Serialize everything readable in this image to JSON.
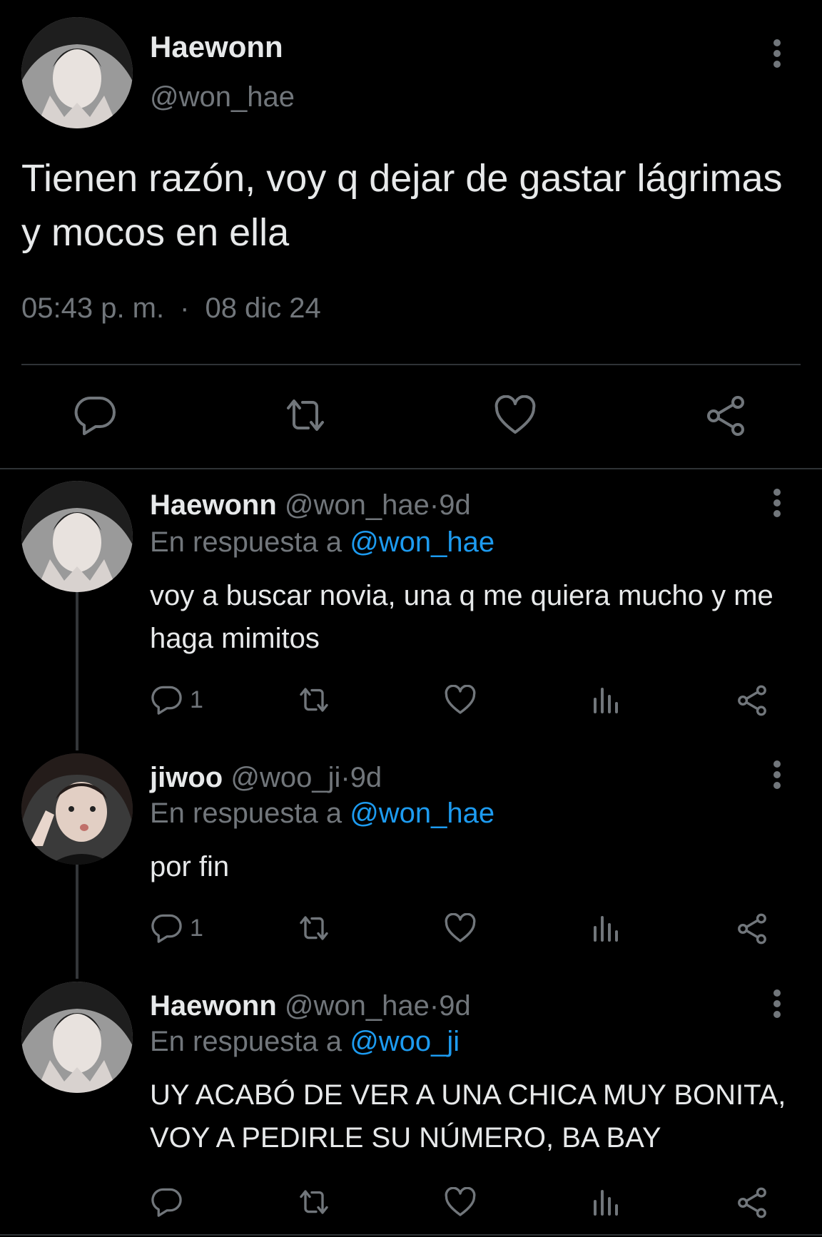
{
  "main_tweet": {
    "name": "Haewonn",
    "handle": "@won_hae",
    "text": "Tienen razón, voy q dejar de gastar lágrimas y mocos en ella",
    "time": "05:43 p. m.",
    "separator": "·",
    "date": "08 dic 24"
  },
  "replies": [
    {
      "name": "Haewonn",
      "handle": "@won_hae",
      "sep": "·",
      "age": "9d",
      "reply_prefix": "En respuesta a",
      "reply_to": "@won_hae",
      "text": "voy a buscar novia, una q me quiera mucho y me haga mimitos",
      "reply_count": "1"
    },
    {
      "name": "jiwoo",
      "handle": "@woo_ji",
      "sep": "·",
      "age": "9d",
      "reply_prefix": "En respuesta a",
      "reply_to": "@won_hae",
      "text": "por fin",
      "reply_count": "1"
    },
    {
      "name": "Haewonn",
      "handle": "@won_hae",
      "sep": "·",
      "age": "9d",
      "reply_prefix": "En respuesta a",
      "reply_to": "@woo_ji",
      "text": "UY ACABÓ DE VER A UNA CHICA MUY BONITA, VOY A PEDIRLE SU NÚMERO, BA BAY",
      "reply_count": ""
    }
  ],
  "icons": {
    "reply": "speech-bubble-icon",
    "retweet": "retweet-arrows-icon",
    "like": "heart-icon",
    "views": "bar-chart-icon",
    "share": "share-nodes-icon",
    "more": "vertical-ellipsis-icon"
  },
  "colors": {
    "background": "#000000",
    "text": "#e7e9ea",
    "muted": "#71767b",
    "link": "#1d9bf0",
    "divider": "#2f3336"
  }
}
